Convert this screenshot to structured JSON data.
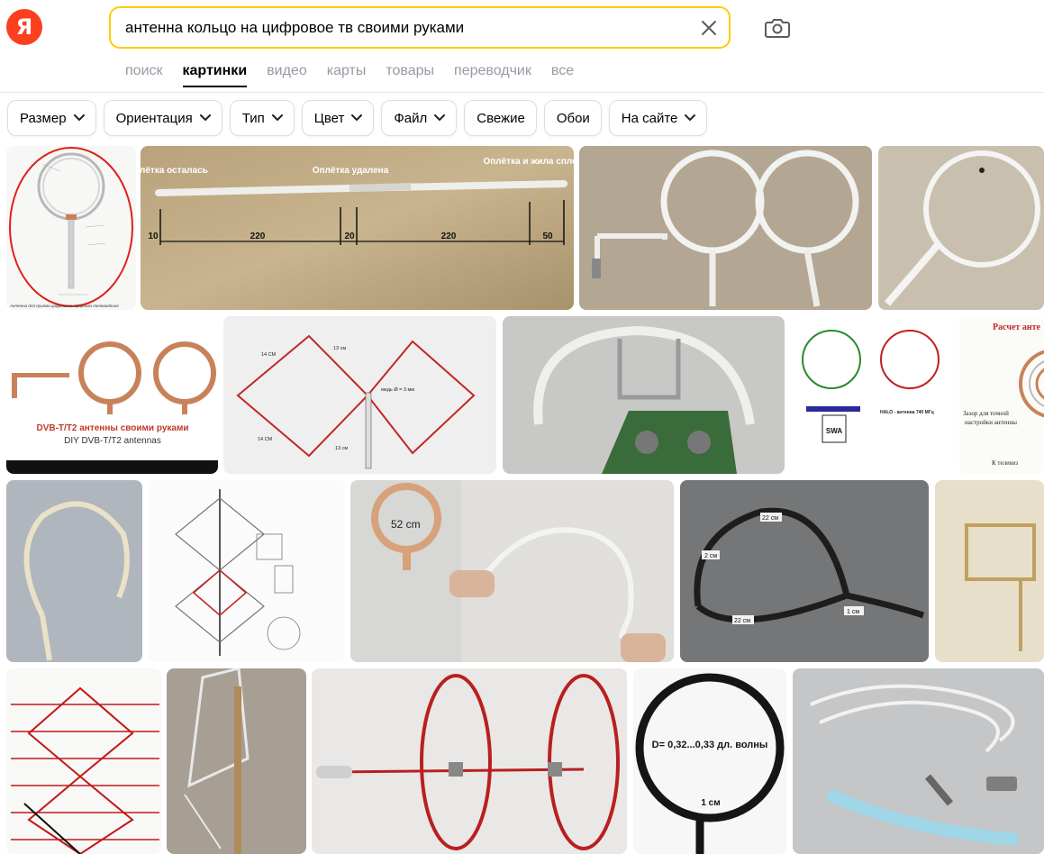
{
  "search": {
    "query": "антенна кольцо на цифровое тв своими руками"
  },
  "logo": {
    "letter": "Я"
  },
  "tabs": [
    "поиск",
    "картинки",
    "видео",
    "карты",
    "товары",
    "переводчик",
    "все"
  ],
  "active_tab": "картинки",
  "filters": [
    {
      "label": "Размер",
      "has_dropdown": true
    },
    {
      "label": "Ориентация",
      "has_dropdown": true
    },
    {
      "label": "Тип",
      "has_dropdown": true
    },
    {
      "label": "Цвет",
      "has_dropdown": true
    },
    {
      "label": "Файл",
      "has_dropdown": true
    },
    {
      "label": "Свежие",
      "has_dropdown": false
    },
    {
      "label": "Обои",
      "has_dropdown": false
    },
    {
      "label": "На сайте",
      "has_dropdown": true
    }
  ],
  "images": {
    "img1": {
      "caption": "Антенна для приема цифрового эфирного телевидения"
    },
    "img2": {
      "label_left": "Оплётка осталась",
      "label_mid": "Оплётка удалена",
      "label_right": "Оплётка и жила сплетены",
      "dims": [
        "10",
        "220",
        "20",
        "220",
        "50"
      ]
    },
    "img5": {
      "title_line1": "DVB-T/T2 антенны своими руками",
      "title_line2": "DIY DVB-T/T2 antennas"
    },
    "img6": {
      "dim1": "14 СМ",
      "dim2": "13 см",
      "dim3": "14 СМ",
      "dim4": "13 см",
      "note": "медь Ø = 3 мм"
    },
    "img8": {
      "label": "SWA",
      "title": "HALO - антенна 740 МГц"
    },
    "img9": {
      "title": "Расчет анте",
      "note1": "Зазор для точной",
      "note2": "настройки антенны",
      "note3": "К телевиз"
    },
    "img12": {
      "label": "52 cm"
    },
    "img13": {
      "label1": "22 см",
      "label2": "2 см",
      "label3": "22 см",
      "label4": "1 см"
    },
    "img19": {
      "label1": "D= 0,32...0,33 дл. волны",
      "label2": "1 см"
    }
  },
  "colors": {
    "accent": "#ffcc00",
    "logo": "#fc3f1d",
    "tab_inactive": "#979aa3"
  }
}
